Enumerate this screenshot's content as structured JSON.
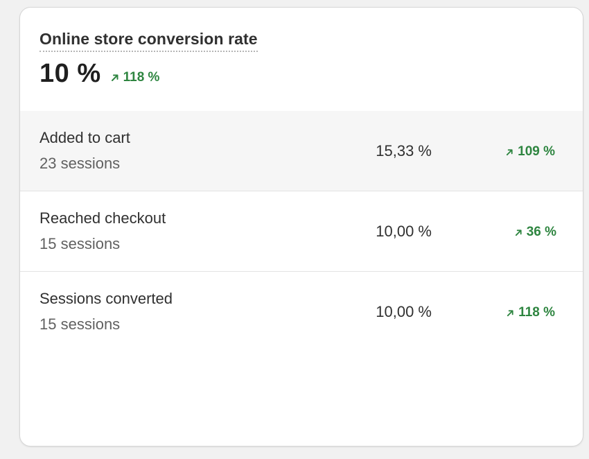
{
  "card": {
    "title": "Online store conversion rate",
    "value": "10 %",
    "change": "118 %",
    "change_direction": "up",
    "accent_color": "#2e8540"
  },
  "rows": [
    {
      "label": "Added to cart",
      "sessions": "23 sessions",
      "rate": "15,33 %",
      "change": "109 %"
    },
    {
      "label": "Reached checkout",
      "sessions": "15 sessions",
      "rate": "10,00 %",
      "change": "36 %"
    },
    {
      "label": "Sessions converted",
      "sessions": "15 sessions",
      "rate": "10,00 %",
      "change": "118 %"
    }
  ],
  "icons": {
    "trend": "arrow-up-right-icon"
  }
}
